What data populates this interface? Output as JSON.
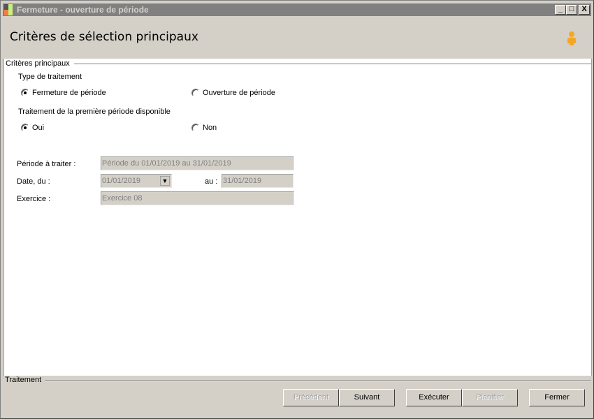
{
  "window": {
    "title": "Fermeture - ouverture de période",
    "minimize": "_",
    "maximize": "□",
    "close": "X"
  },
  "header": {
    "title": "Critères de sélection principaux"
  },
  "criteria": {
    "group_title": "Critères principaux",
    "type_label": "Type de traitement",
    "type_options": [
      {
        "label": "Fermeture de période",
        "selected": true
      },
      {
        "label": "Ouverture de période",
        "selected": false
      }
    ],
    "first_label": "Traitement de la première période disponible",
    "first_options": [
      {
        "label": "Oui",
        "selected": true
      },
      {
        "label": "Non",
        "selected": false
      }
    ],
    "periode_label": "Période à traiter :",
    "periode_value": "Période du 01/01/2019 au 31/01/2019",
    "date_from_label": "Date, du :",
    "date_from_value": "01/01/2019",
    "date_to_label": "au :",
    "date_to_value": "31/01/2019",
    "exercice_label": "Exercice :",
    "exercice_value": "Exercice 08"
  },
  "footer": {
    "group_title": "Traitement",
    "buttons": {
      "previous": "Précédent",
      "next": "Suivant",
      "execute": "Exécuter",
      "schedule": "Planifier",
      "close": "Fermer"
    }
  }
}
